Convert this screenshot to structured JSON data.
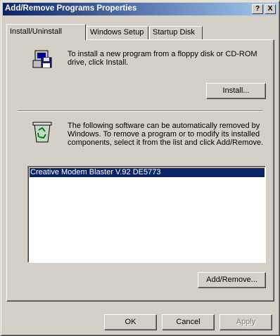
{
  "window": {
    "title": "Add/Remove Programs Properties"
  },
  "titlebar_buttons": {
    "help": "?",
    "close": "X"
  },
  "tabs": [
    {
      "label": "Install/Uninstall"
    },
    {
      "label": "Windows Setup"
    },
    {
      "label": "Startup Disk"
    }
  ],
  "install": {
    "text": "To install a new program from a floppy disk or CD-ROM drive, click Install.",
    "button_label": "Install...",
    "icon": "floppy-computer-icon"
  },
  "uninstall": {
    "text": "The following software can be automatically removed by Windows. To remove a program or to modify its installed components, select it from the list and click Add/Remove.",
    "icon": "recycle-bin-icon"
  },
  "program_list": {
    "items": [
      "Creative Modem Blaster V.92 DE5773"
    ]
  },
  "add_remove_button": "Add/Remove...",
  "footer": {
    "ok": "OK",
    "cancel": "Cancel",
    "apply": "Apply"
  },
  "colors": {
    "titlebar_start": "#0a246a",
    "titlebar_end": "#a6caf0",
    "face": "#d4d0c8",
    "selection": "#0a246a"
  }
}
